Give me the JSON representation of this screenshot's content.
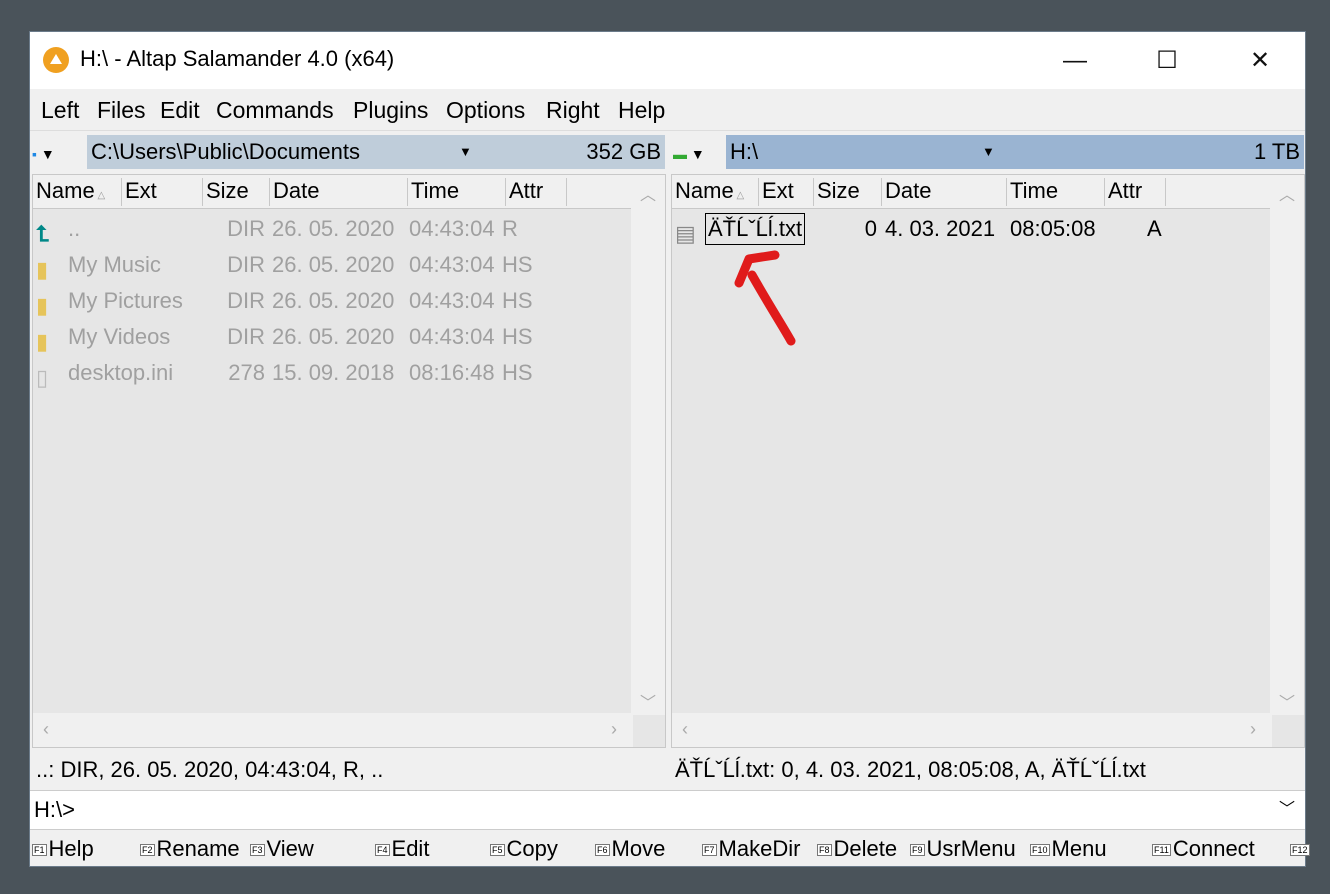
{
  "window": {
    "title": "H:\\ - Altap Salamander 4.0 (x64)",
    "minimize": "—",
    "maximize": "☐",
    "close": "✕"
  },
  "menu": [
    "Left",
    "Files",
    "Edit",
    "Commands",
    "Plugins",
    "Options",
    "Right",
    "Help"
  ],
  "left": {
    "path": "C:\\Users\\Public\\Documents",
    "free": "352 GB",
    "columns": [
      "Name",
      "Ext",
      "Size",
      "Date",
      "Time",
      "Attr"
    ],
    "rows": [
      {
        "name": "..",
        "size": "DIR",
        "date": "26. 05. 2020",
        "time": "04:43:04",
        "attr": "R",
        "icon": "up-dir-icon"
      },
      {
        "name": "My Music",
        "size": "DIR",
        "date": "26. 05. 2020",
        "time": "04:43:04",
        "attr": "HS",
        "icon": "folder-link-icon"
      },
      {
        "name": "My Pictures",
        "size": "DIR",
        "date": "26. 05. 2020",
        "time": "04:43:04",
        "attr": "HS",
        "icon": "folder-link-icon"
      },
      {
        "name": "My Videos",
        "size": "DIR",
        "date": "26. 05. 2020",
        "time": "04:43:04",
        "attr": "HS",
        "icon": "folder-link-icon"
      },
      {
        "name": "desktop.ini",
        "size": "278",
        "date": "15. 09. 2018",
        "time": "08:16:48",
        "attr": "HS",
        "icon": "ini-file-icon"
      }
    ],
    "status": "..: DIR, 26. 05. 2020, 04:43:04, R, .."
  },
  "right": {
    "path": "H:\\",
    "free": "1 TB",
    "columns": [
      "Name",
      "Ext",
      "Size",
      "Date",
      "Time",
      "Attr"
    ],
    "rows": [
      {
        "name": "ÄŤĹˇĹĺ.txt",
        "size": "0",
        "date": "4. 03. 2021",
        "time": "08:05:08",
        "attr": "A",
        "icon": "text-file-icon"
      }
    ],
    "status": "ÄŤĹˇĹĺ.txt: 0, 4. 03. 2021, 08:05:08, A, ÄŤĹˇĹĺ.txt"
  },
  "command_line": "H:\\>",
  "fkeys": [
    [
      "F1",
      "Help"
    ],
    [
      "F2",
      "Rename"
    ],
    [
      "F3",
      "View"
    ],
    [
      "F4",
      "Edit"
    ],
    [
      "F5",
      "Copy"
    ],
    [
      "F6",
      "Move"
    ],
    [
      "F7",
      "MakeDir"
    ],
    [
      "F8",
      "Delete"
    ],
    [
      "F9",
      "UsrMenu"
    ],
    [
      "F10",
      "Menu"
    ],
    [
      "F11",
      "Connect"
    ],
    [
      "F12",
      ""
    ]
  ],
  "colors": {
    "left_path_bg": "#bfcdda",
    "right_path_bg": "#9ab4d2",
    "annotation_arrow": "#e01b1b"
  }
}
